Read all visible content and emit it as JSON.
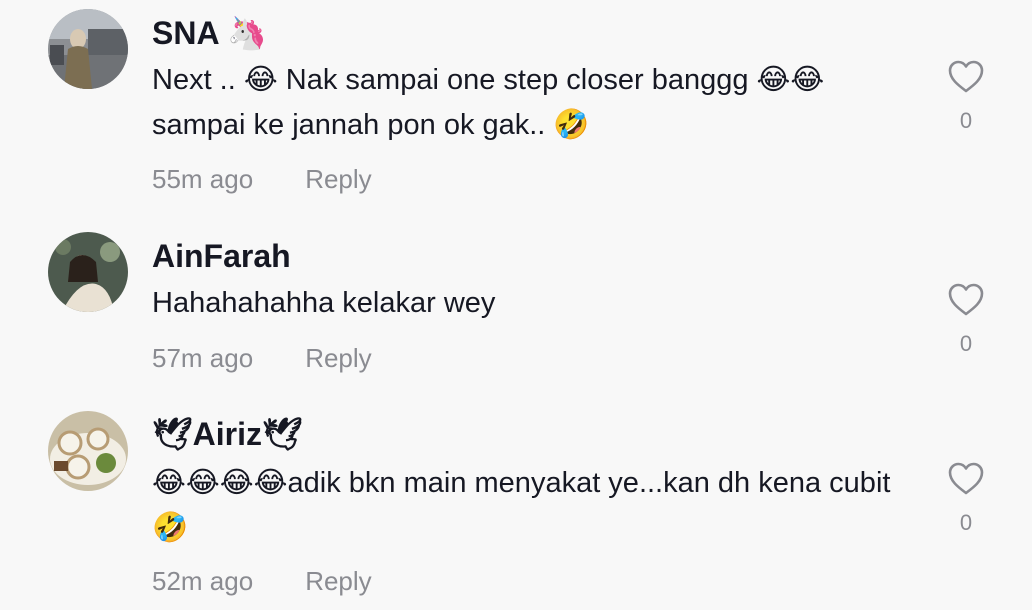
{
  "comments": [
    {
      "username": "SNA 🦄",
      "text": "Next .. 😂 Nak sampai one step closer banggg 😂😂 sampai ke jannah pon ok gak.. 🤣",
      "time": "55m ago",
      "reply_label": "Reply",
      "like_count": "0",
      "avatar_icon": "user-avatar-sna"
    },
    {
      "username": "AinFarah",
      "text": "Hahahahahha kelakar wey",
      "time": "57m ago",
      "reply_label": "Reply",
      "like_count": "0",
      "avatar_icon": "user-avatar-ainfarah"
    },
    {
      "username": "🕊Airiz🕊",
      "text": "😂😂😂😂adik bkn main menyakat ye...kan dh kena cubit🤣",
      "time": "52m ago",
      "reply_label": "Reply",
      "like_count": "0",
      "avatar_icon": "user-avatar-airiz"
    }
  ],
  "colors": {
    "background": "#f8f8f8",
    "text_primary": "#161823",
    "text_secondary": "#8a8b91",
    "heart_outline": "#8a8b91"
  },
  "icons": {
    "like": "heart-outline-icon"
  }
}
